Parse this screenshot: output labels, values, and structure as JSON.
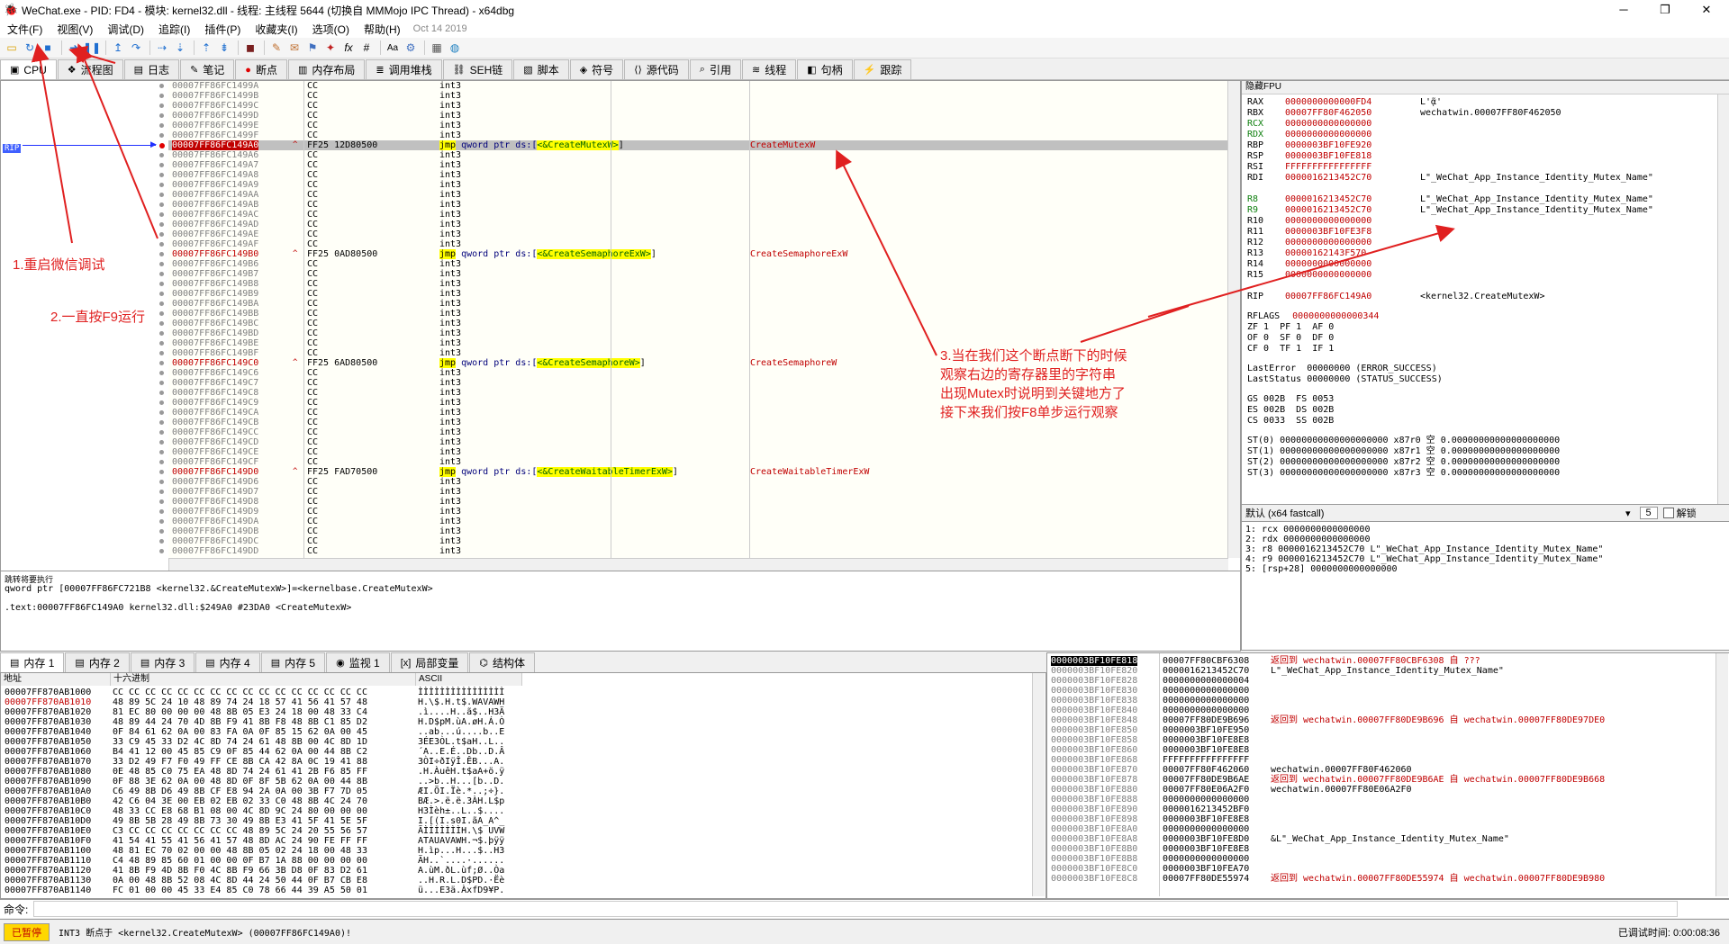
{
  "window": {
    "title": "WeChat.exe - PID: FD4 - 模块: kernel32.dll - 线程: 主线程 5644 (切换自 MMMojo IPC Thread) - x64dbg",
    "controls": [
      "─",
      "❐",
      "✕"
    ]
  },
  "menu": {
    "items": [
      "文件(F)",
      "视图(V)",
      "调试(D)",
      "追踪(I)",
      "插件(P)",
      "收藏夹(I)",
      "选项(O)",
      "帮助(H)"
    ],
    "date": "Oct 14 2019"
  },
  "tabs": [
    {
      "label": "CPU",
      "icon": "cpu-icon"
    },
    {
      "label": "流程图",
      "icon": "graph-icon"
    },
    {
      "label": "日志",
      "icon": "log-icon"
    },
    {
      "label": "笔记",
      "icon": "notes-icon"
    },
    {
      "label": "断点",
      "icon": "breakpoint-icon"
    },
    {
      "label": "内存布局",
      "icon": "memory-map-icon"
    },
    {
      "label": "调用堆栈",
      "icon": "callstack-icon"
    },
    {
      "label": "SEH链",
      "icon": "seh-icon"
    },
    {
      "label": "脚本",
      "icon": "script-icon"
    },
    {
      "label": "符号",
      "icon": "symbols-icon"
    },
    {
      "label": "源代码",
      "icon": "source-icon"
    },
    {
      "label": "引用",
      "icon": "references-icon"
    },
    {
      "label": "线程",
      "icon": "threads-icon"
    },
    {
      "label": "句柄",
      "icon": "handles-icon"
    },
    {
      "label": "跟踪",
      "icon": "trace-icon"
    }
  ],
  "disasm": {
    "rip_label": "RIP",
    "rows": [
      {
        "addr": "00007FF86FC1499A",
        "bytes": "CC",
        "instr": "int3"
      },
      {
        "addr": "00007FF86FC1499B",
        "bytes": "CC",
        "instr": "int3"
      },
      {
        "addr": "00007FF86FC1499C",
        "bytes": "CC",
        "instr": "int3"
      },
      {
        "addr": "00007FF86FC1499D",
        "bytes": "CC",
        "instr": "int3"
      },
      {
        "addr": "00007FF86FC1499E",
        "bytes": "CC",
        "instr": "int3"
      },
      {
        "addr": "00007FF86FC1499F",
        "bytes": "CC",
        "instr": "int3"
      },
      {
        "addr": "00007FF86FC149A0",
        "bytes": "FF25 12D80500",
        "pre": "jmp",
        "instr": "qword ptr ds:[",
        "sym": "<&CreateMutexW>",
        "post": "]",
        "cmt": "CreateMutexW",
        "kind": "rip"
      },
      {
        "addr": "00007FF86FC149A6",
        "bytes": "CC",
        "instr": "int3"
      },
      {
        "addr": "00007FF86FC149A7",
        "bytes": "CC",
        "instr": "int3"
      },
      {
        "addr": "00007FF86FC149A8",
        "bytes": "CC",
        "instr": "int3"
      },
      {
        "addr": "00007FF86FC149A9",
        "bytes": "CC",
        "instr": "int3"
      },
      {
        "addr": "00007FF86FC149AA",
        "bytes": "CC",
        "instr": "int3"
      },
      {
        "addr": "00007FF86FC149AB",
        "bytes": "CC",
        "instr": "int3"
      },
      {
        "addr": "00007FF86FC149AC",
        "bytes": "CC",
        "instr": "int3"
      },
      {
        "addr": "00007FF86FC149AD",
        "bytes": "CC",
        "instr": "int3"
      },
      {
        "addr": "00007FF86FC149AE",
        "bytes": "CC",
        "instr": "int3"
      },
      {
        "addr": "00007FF86FC149AF",
        "bytes": "CC",
        "instr": "int3"
      },
      {
        "addr": "00007FF86FC149B0",
        "bytes": "FF25 0AD80500",
        "pre": "jmp",
        "instr": "qword ptr ds:[",
        "sym": "<&CreateSemaphoreExW>",
        "post": "]",
        "cmt": "CreateSemaphoreExW",
        "kind": "fn"
      },
      {
        "addr": "00007FF86FC149B6",
        "bytes": "CC",
        "instr": "int3"
      },
      {
        "addr": "00007FF86FC149B7",
        "bytes": "CC",
        "instr": "int3"
      },
      {
        "addr": "00007FF86FC149B8",
        "bytes": "CC",
        "instr": "int3"
      },
      {
        "addr": "00007FF86FC149B9",
        "bytes": "CC",
        "instr": "int3"
      },
      {
        "addr": "00007FF86FC149BA",
        "bytes": "CC",
        "instr": "int3"
      },
      {
        "addr": "00007FF86FC149BB",
        "bytes": "CC",
        "instr": "int3"
      },
      {
        "addr": "00007FF86FC149BC",
        "bytes": "CC",
        "instr": "int3"
      },
      {
        "addr": "00007FF86FC149BD",
        "bytes": "CC",
        "instr": "int3"
      },
      {
        "addr": "00007FF86FC149BE",
        "bytes": "CC",
        "instr": "int3"
      },
      {
        "addr": "00007FF86FC149BF",
        "bytes": "CC",
        "instr": "int3"
      },
      {
        "addr": "00007FF86FC149C0",
        "bytes": "FF25 6AD80500",
        "pre": "jmp",
        "instr": "qword ptr ds:[",
        "sym": "<&CreateSemaphoreW>",
        "post": "]",
        "cmt": "CreateSemaphoreW",
        "kind": "fn"
      },
      {
        "addr": "00007FF86FC149C6",
        "bytes": "CC",
        "instr": "int3"
      },
      {
        "addr": "00007FF86FC149C7",
        "bytes": "CC",
        "instr": "int3"
      },
      {
        "addr": "00007FF86FC149C8",
        "bytes": "CC",
        "instr": "int3"
      },
      {
        "addr": "00007FF86FC149C9",
        "bytes": "CC",
        "instr": "int3"
      },
      {
        "addr": "00007FF86FC149CA",
        "bytes": "CC",
        "instr": "int3"
      },
      {
        "addr": "00007FF86FC149CB",
        "bytes": "CC",
        "instr": "int3"
      },
      {
        "addr": "00007FF86FC149CC",
        "bytes": "CC",
        "instr": "int3"
      },
      {
        "addr": "00007FF86FC149CD",
        "bytes": "CC",
        "instr": "int3"
      },
      {
        "addr": "00007FF86FC149CE",
        "bytes": "CC",
        "instr": "int3"
      },
      {
        "addr": "00007FF86FC149CF",
        "bytes": "CC",
        "instr": "int3"
      },
      {
        "addr": "00007FF86FC149D0",
        "bytes": "FF25 FAD70500",
        "pre": "jmp",
        "instr": "qword ptr ds:[",
        "sym": "<&CreateWaitableTimerExW>",
        "post": "]",
        "cmt": "CreateWaitableTimerExW",
        "kind": "fn"
      },
      {
        "addr": "00007FF86FC149D6",
        "bytes": "CC",
        "instr": "int3"
      },
      {
        "addr": "00007FF86FC149D7",
        "bytes": "CC",
        "instr": "int3"
      },
      {
        "addr": "00007FF86FC149D8",
        "bytes": "CC",
        "instr": "int3"
      },
      {
        "addr": "00007FF86FC149D9",
        "bytes": "CC",
        "instr": "int3"
      },
      {
        "addr": "00007FF86FC149DA",
        "bytes": "CC",
        "instr": "int3"
      },
      {
        "addr": "00007FF86FC149DB",
        "bytes": "CC",
        "instr": "int3"
      },
      {
        "addr": "00007FF86FC149DC",
        "bytes": "CC",
        "instr": "int3"
      },
      {
        "addr": "00007FF86FC149DD",
        "bytes": "CC",
        "instr": "int3"
      }
    ]
  },
  "info": {
    "line1": "跳转将要执行",
    "line2": "qword ptr [00007FF86FC721B8 <kernel32.&CreateMutexW>]=<kernelbase.CreateMutexW>",
    "line3": ".text:00007FF86FC149A0 kernel32.dll:$249A0 #23DA0 <CreateMutexW>"
  },
  "registers": {
    "header": "隐藏FPU",
    "lines": [
      {
        "n": "RAX",
        "v": "0000000000000FD4",
        "c": "L'ᾷ'"
      },
      {
        "n": "RBX",
        "v": "00007FF80F462050",
        "c": "wechatwin.00007FF80F462050"
      },
      {
        "n": "RCX",
        "v": "0000000000000000",
        "c": ""
      },
      {
        "n": "RDX",
        "v": "0000000000000000",
        "c": ""
      },
      {
        "n": "RBP",
        "v": "0000003BF10FE920",
        "c": ""
      },
      {
        "n": "RSP",
        "v": "0000003BF10FE818",
        "c": ""
      },
      {
        "n": "RSI",
        "v": "FFFFFFFFFFFFFFFF",
        "c": ""
      },
      {
        "n": "RDI",
        "v": "0000016213452C70",
        "c": "L\"_WeChat_App_Instance_Identity_Mutex_Name\""
      },
      {
        "n": "",
        "v": "",
        "c": ""
      },
      {
        "n": "R8",
        "v": "0000016213452C70",
        "c": "L\"_WeChat_App_Instance_Identity_Mutex_Name\""
      },
      {
        "n": "R9",
        "v": "0000016213452C70",
        "c": "L\"_WeChat_App_Instance_Identity_Mutex_Name\""
      },
      {
        "n": "R10",
        "v": "0000000000000000",
        "c": ""
      },
      {
        "n": "R11",
        "v": "0000003BF10FE3F8",
        "c": ""
      },
      {
        "n": "R12",
        "v": "0000000000000000",
        "c": ""
      },
      {
        "n": "R13",
        "v": "00000162143F570",
        "c": ""
      },
      {
        "n": "R14",
        "v": "0000000000000000",
        "c": ""
      },
      {
        "n": "R15",
        "v": "0000000000000000",
        "c": ""
      },
      {
        "n": "",
        "v": "",
        "c": ""
      },
      {
        "n": "RIP",
        "v": "00007FF86FC149A0",
        "c": "<kernel32.CreateMutexW>"
      }
    ],
    "rflags_label": "RFLAGS",
    "rflags": "0000000000000344",
    "flags": [
      "ZF 1  PF 1  AF 0",
      "OF 0  SF 0  DF 0",
      "CF 0  TF 1  IF 1"
    ],
    "lasterror": "LastError  00000000 (ERROR_SUCCESS)",
    "laststatus": "LastStatus 00000000 (STATUS_SUCCESS)",
    "segs": [
      "GS 002B  FS 0053",
      "ES 002B  DS 002B",
      "CS 0033  SS 002B"
    ],
    "fpu": [
      "ST(0) 00000000000000000000 x87r0 空 0.00000000000000000000",
      "ST(1) 00000000000000000000 x87r1 空 0.00000000000000000000",
      "ST(2) 00000000000000000000 x87r2 空 0.00000000000000000000",
      "ST(3) 00000000000000000000 x87r3 空 0.00000000000000000000"
    ]
  },
  "args": {
    "convention": "默认 (x64 fastcall)",
    "count": "5",
    "unlock_label": "解锁",
    "lines": [
      "1: rcx 0000000000000000",
      "2: rdx 0000000000000000",
      "3: r8 0000016213452C70 L\"_WeChat_App_Instance_Identity_Mutex_Name\"",
      "4: r9 0000016213452C70 L\"_WeChat_App_Instance_Identity_Mutex_Name\"",
      "5: [rsp+28] 0000000000000000"
    ]
  },
  "dump_tabs": [
    {
      "label": "内存 1",
      "icon": "memory-icon"
    },
    {
      "label": "内存 2",
      "icon": "memory-icon"
    },
    {
      "label": "内存 3",
      "icon": "memory-icon"
    },
    {
      "label": "内存 4",
      "icon": "memory-icon"
    },
    {
      "label": "内存 5",
      "icon": "memory-icon"
    },
    {
      "label": "监视 1",
      "icon": "watch-icon"
    },
    {
      "label": "局部变量",
      "icon": "locals-icon"
    },
    {
      "label": "结构体",
      "icon": "struct-icon"
    }
  ],
  "dump": {
    "headers": [
      "地址",
      "十六进制",
      "ASCII"
    ],
    "rows": [
      {
        "a": "00007FF870AB1000",
        "h": "CC CC CC CC CC CC CC CC CC CC CC CC CC CC CC CC",
        "s": "ÌÌÌÌÌÌÌÌÌÌÌÌÌÌÌÌ"
      },
      {
        "a": "00007FF870AB1010",
        "h": "48 89 5C 24 10 48 89 74 24 18 57 41 56 41 57 48",
        "s": "H.\\$.H.t$.WAVAWH"
      },
      {
        "a": "00007FF870AB1020",
        "h": "81 EC 80 00 00 00 48 8B 05 E3 24 18 00 48 33 C4",
        "s": ".ì....H..ã$..H3Ä"
      },
      {
        "a": "00007FF870AB1030",
        "h": "48 89 44 24 70 4D 8B F9 41 8B F8 48 8B C1 85 D2",
        "s": "H.D$pM.ùA.øH.Á.Ò"
      },
      {
        "a": "00007FF870AB1040",
        "h": "0F 84 61 62 0A 00 83 FA 0A 0F 85 15 62 0A 00 45",
        "s": "..ab...ú....b..E"
      },
      {
        "a": "00007FF870AB1050",
        "h": "33 C9 45 33 D2 4C 8D 74 24 61 48 8B 00 4C 8D 1D",
        "s": "3ÉE3ÒL.t$aH..L.."
      },
      {
        "a": "00007FF870AB1060",
        "h": "B4 41 12 00 45 85 C9 0F 85 44 62 0A 00 44 8B C2",
        "s": "´A..E.É..Db..D.Â"
      },
      {
        "a": "00007FF870AB1070",
        "h": "33 D2 49 F7 F0 49 FF CE 8B CA 42 8A 0C 19 41 88",
        "s": "3ÒI÷ðIÿÎ.ÊB...A."
      },
      {
        "a": "00007FF870AB1080",
        "h": "0E 48 85 C0 75 EA 48 8D 74 24 61 41 2B F6 85 FF",
        "s": ".H.ÀuêH.t$aA+ö.ÿ"
      },
      {
        "a": "00007FF870AB1090",
        "h": "0F 88 3E 62 0A 00 48 8D 0F 8F 5B 62 0A 00 44 8B",
        "s": "..>b..H...[b..D."
      },
      {
        "a": "00007FF870AB10A0",
        "h": "C6 49 8B D6 49 8B CF E8 94 2A 0A 00 3B F7 7D 05",
        "s": "ÆI.ÖI.Ïè.*..;÷}."
      },
      {
        "a": "00007FF870AB10B0",
        "h": "42 C6 04 3E 00 EB 02 EB 02 33 C0 48 8B 4C 24 70",
        "s": "BÆ.>.ë.ë.3ÀH.L$p"
      },
      {
        "a": "00007FF870AB10C0",
        "h": "48 33 CC E8 68 B1 08 00 4C 8D 9C 24 80 00 00 00",
        "s": "H3Ìèh±..L..$...."
      },
      {
        "a": "00007FF870AB10D0",
        "h": "49 8B 5B 28 49 8B 73 30 49 8B E3 41 5F 41 5E 5F",
        "s": "I.[(I.s0I.ãA_A^_"
      },
      {
        "a": "00007FF870AB10E0",
        "h": "C3 CC CC CC CC CC CC CC 48 89 5C 24 20 55 56 57",
        "s": "ÃÌÌÌÌÌÌÌH.\\$ UVW"
      },
      {
        "a": "00007FF870AB10F0",
        "h": "41 54 41 55 41 56 41 57 48 8D AC 24 90 FE FF FF",
        "s": "ATAUAVAWH.¬$.þÿÿ"
      },
      {
        "a": "00007FF870AB1100",
        "h": "48 81 EC 70 02 00 00 48 8B 05 02 24 18 00 48 33",
        "s": "H.ìp...H...$..H3"
      },
      {
        "a": "00007FF870AB1110",
        "h": "C4 48 89 85 60 01 00 00 0F B7 1A 88 00 00 00 00",
        "s": "ÄH..`....·......"
      },
      {
        "a": "00007FF870AB1120",
        "h": "41 8B F9 4D 8B F0 4C 8B F9 66 3B D8 0F 83 D2 61",
        "s": "A.ùM.ðL.ùf;Ø..Òa"
      },
      {
        "a": "00007FF870AB1130",
        "h": "0A 00 48 8B 52 08 4C 8D 44 24 50 44 0F B7 CB E8",
        "s": "..H.R.L.D$PD.·Ëè"
      },
      {
        "a": "00007FF870AB1140",
        "h": "FC 01 00 00 45 33 E4 85 C0 78 66 44 39 A5 50 01",
        "s": "ü...E3ä.ÀxfD9¥P."
      }
    ]
  },
  "stack": {
    "rows": [
      {
        "a": "0000003BF10FE818",
        "v": "00007FF80CBF6308",
        "c": "返回到 wechatwin.00007FF80CBF6308 自 ???",
        "k": "ret"
      },
      {
        "a": "0000003BF10FE820",
        "v": "0000016213452C70",
        "c": "L\"_WeChat_App_Instance_Identity_Mutex_Name\"",
        "k": "str"
      },
      {
        "a": "0000003BF10FE828",
        "v": "0000000000000004",
        "c": "",
        "k": ""
      },
      {
        "a": "0000003BF10FE830",
        "v": "0000000000000000",
        "c": "",
        "k": ""
      },
      {
        "a": "0000003BF10FE838",
        "v": "0000000000000000",
        "c": "",
        "k": ""
      },
      {
        "a": "0000003BF10FE840",
        "v": "0000000000000000",
        "c": "",
        "k": ""
      },
      {
        "a": "0000003BF10FE848",
        "v": "00007FF80DE9B696",
        "c": "返回到 wechatwin.00007FF80DE9B696 自 wechatwin.00007FF80DE97DE0",
        "k": "ret"
      },
      {
        "a": "0000003BF10FE850",
        "v": "0000003BF10FE950",
        "c": "",
        "k": ""
      },
      {
        "a": "0000003BF10FE858",
        "v": "0000003BF10FE8E8",
        "c": "",
        "k": ""
      },
      {
        "a": "0000003BF10FE860",
        "v": "0000003BF10FE8E8",
        "c": "",
        "k": ""
      },
      {
        "a": "0000003BF10FE868",
        "v": "FFFFFFFFFFFFFFFF",
        "c": "",
        "k": ""
      },
      {
        "a": "0000003BF10FE870",
        "v": "00007FF80F462060",
        "c": "wechatwin.00007FF80F462060",
        "k": "str"
      },
      {
        "a": "0000003BF10FE878",
        "v": "00007FF80DE9B6AE",
        "c": "返回到 wechatwin.00007FF80DE9B6AE 自 wechatwin.00007FF80DE9B668",
        "k": "ret"
      },
      {
        "a": "0000003BF10FE880",
        "v": "00007FF80E06A2F0",
        "c": "wechatwin.00007FF80E06A2F0",
        "k": "str"
      },
      {
        "a": "0000003BF10FE888",
        "v": "0000000000000000",
        "c": "",
        "k": ""
      },
      {
        "a": "0000003BF10FE890",
        "v": "0000016213452BF0",
        "c": "",
        "k": ""
      },
      {
        "a": "0000003BF10FE898",
        "v": "0000003BF10FE8E8",
        "c": "",
        "k": ""
      },
      {
        "a": "0000003BF10FE8A0",
        "v": "0000000000000000",
        "c": "",
        "k": ""
      },
      {
        "a": "0000003BF10FE8A8",
        "v": "0000003BF10FE8D0",
        "c": "&L\"_WeChat_App_Instance_Identity_Mutex_Name\"",
        "k": "str"
      },
      {
        "a": "0000003BF10FE8B0",
        "v": "0000003BF10FE8E8",
        "c": "",
        "k": ""
      },
      {
        "a": "0000003BF10FE8B8",
        "v": "0000000000000000",
        "c": "",
        "k": ""
      },
      {
        "a": "0000003BF10FE8C0",
        "v": "0000003BF10FEA70",
        "c": "",
        "k": ""
      },
      {
        "a": "0000003BF10FE8C8",
        "v": "00007FF80DE55974",
        "c": "返回到 wechatwin.00007FF80DE55974 自 wechatwin.00007FF80DE9B980",
        "k": "ret"
      }
    ]
  },
  "command": {
    "label": "命令:",
    "value": ""
  },
  "status": {
    "paused": "已暂停",
    "message": "INT3 断点于 <kernel32.CreateMutexW> (00007FF86FC149A0)!",
    "right": "已调试时间: 0:00:08:36"
  },
  "annotations": {
    "note1": "1.重启微信调试",
    "note2": "2.一直按F9运行",
    "note3": "3.当在我们这个断点断下的时候\n观察右边的寄存器里的字符串\n出现Mutex时说明到关键地方了\n接下来我们按F8单步运行观察"
  }
}
